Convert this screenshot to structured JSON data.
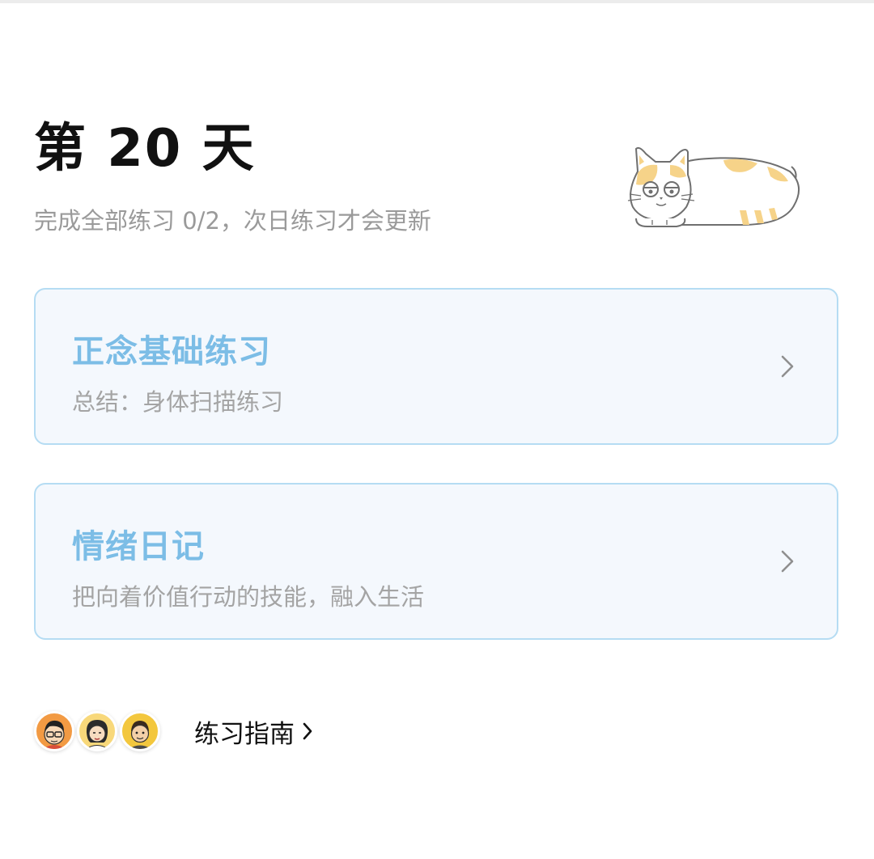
{
  "header": {
    "day_title": "第 20 天",
    "subtitle": "完成全部练习 0/2，次日练习才会更新"
  },
  "mascot": {
    "icon": "sleeping-cat-illustration"
  },
  "practices": [
    {
      "title": "正念基础练习",
      "description": "总结：身体扫描练习",
      "icon": "chevron-right-icon"
    },
    {
      "title": "情绪日记",
      "description": "把向着价值行动的技能，融入生活",
      "icon": "chevron-right-icon"
    }
  ],
  "guide": {
    "label": "练习指南",
    "avatars": [
      "coach-avatar",
      "coach-avatar",
      "coach-avatar"
    ],
    "icon": "chevron-right-icon"
  },
  "colors": {
    "card_border": "#b5dcf3",
    "card_background": "#f4f8fd",
    "card_title": "#7cbde6",
    "muted_text": "#9a9a9a"
  }
}
